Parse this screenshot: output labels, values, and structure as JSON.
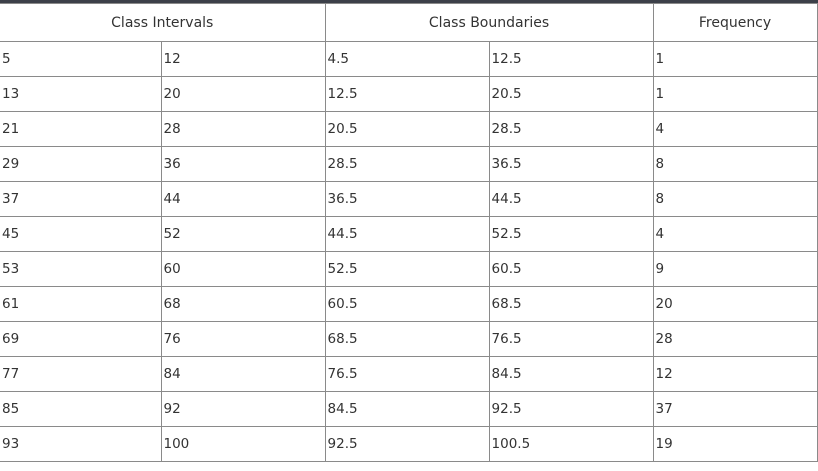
{
  "table": {
    "headers": {
      "class_intervals": "Class Intervals",
      "class_boundaries": "Class Boundaries",
      "frequency": "Frequency"
    },
    "rows": [
      [
        "5",
        "12",
        "4.5",
        "12.5",
        "1"
      ],
      [
        "13",
        "20",
        "12.5",
        "20.5",
        "1"
      ],
      [
        "21",
        "28",
        "20.5",
        "28.5",
        "4"
      ],
      [
        "29",
        "36",
        "28.5",
        "36.5",
        "8"
      ],
      [
        "37",
        "44",
        "36.5",
        "44.5",
        "8"
      ],
      [
        "45",
        "52",
        "44.5",
        "52.5",
        "4"
      ],
      [
        "53",
        "60",
        "52.5",
        "60.5",
        "9"
      ],
      [
        "61",
        "68",
        "60.5",
        "68.5",
        "20"
      ],
      [
        "69",
        "76",
        "68.5",
        "76.5",
        "28"
      ],
      [
        "77",
        "84",
        "76.5",
        "84.5",
        "12"
      ],
      [
        "85",
        "92",
        "84.5",
        "92.5",
        "37"
      ],
      [
        "93",
        "100",
        "92.5",
        "100.5",
        "19"
      ]
    ]
  }
}
